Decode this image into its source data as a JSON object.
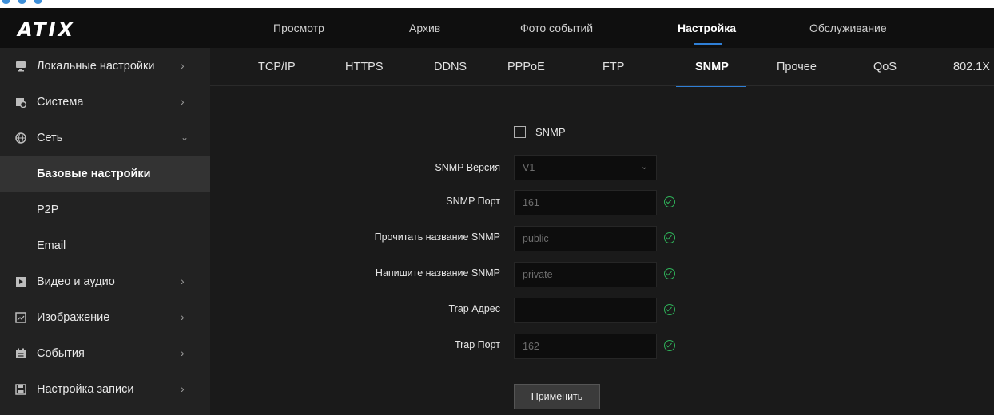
{
  "brand": {
    "logo": "ATIX"
  },
  "top_nav": [
    {
      "label": "Просмотр"
    },
    {
      "label": "Архив"
    },
    {
      "label": "Фото событий"
    },
    {
      "label": "Настройка",
      "active": true
    },
    {
      "label": "Обслуживание"
    }
  ],
  "sidebar": {
    "items": [
      {
        "label": "Локальные настройки",
        "icon": "monitor-icon"
      },
      {
        "label": "Система",
        "icon": "system-icon"
      },
      {
        "label": "Сеть",
        "icon": "globe-icon",
        "expanded": true
      },
      {
        "label": "Базовые настройки",
        "sub": true,
        "active": true
      },
      {
        "label": "P2P",
        "sub": true
      },
      {
        "label": "Email",
        "sub": true
      },
      {
        "label": "Видео и аудио",
        "icon": "video-icon"
      },
      {
        "label": "Изображение",
        "icon": "image-icon"
      },
      {
        "label": "События",
        "icon": "events-icon"
      },
      {
        "label": "Настройка записи",
        "icon": "record-icon"
      }
    ]
  },
  "tabs": [
    {
      "label": "TCP/IP"
    },
    {
      "label": "HTTPS"
    },
    {
      "label": "DDNS"
    },
    {
      "label": "PPPoE"
    },
    {
      "label": "FTP"
    },
    {
      "label": "SNMP",
      "active": true
    },
    {
      "label": "Прочее"
    },
    {
      "label": "QoS"
    },
    {
      "label": "802.1X"
    }
  ],
  "form": {
    "enable_label": "SNMP",
    "enable_checked": false,
    "version_label": "SNMP Версия",
    "version_value": "V1",
    "port_label": "SNMP Порт",
    "port_value": "161",
    "read_label": "Прочитать название SNMP",
    "read_value": "public",
    "write_label": "Напишите название SNMP",
    "write_value": "private",
    "trap_addr_label": "Trap Адрес",
    "trap_addr_value": "",
    "trap_port_label": "Trap Порт",
    "trap_port_value": "162",
    "apply_label": "Применить"
  },
  "colors": {
    "accent": "#2f7fd6",
    "ok": "#2fb35a",
    "background": "#1a1a1a",
    "sidebar": "#222222"
  }
}
